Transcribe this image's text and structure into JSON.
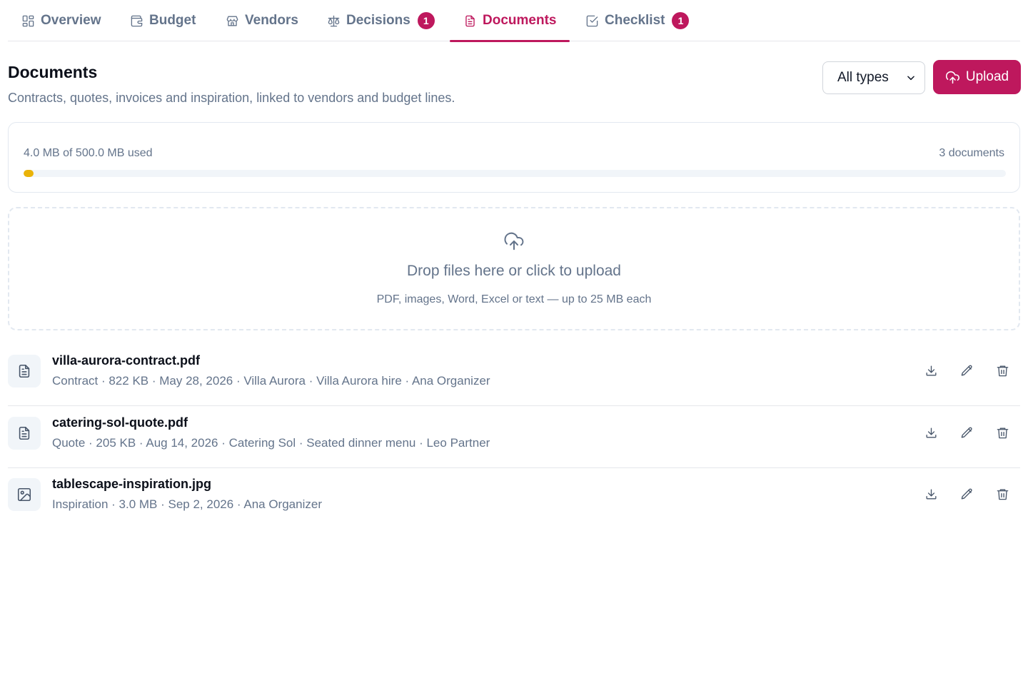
{
  "tabs": [
    {
      "label": "Overview",
      "icon": "grid-icon",
      "badge": null
    },
    {
      "label": "Budget",
      "icon": "wallet-icon",
      "badge": null
    },
    {
      "label": "Vendors",
      "icon": "store-icon",
      "badge": null
    },
    {
      "label": "Decisions",
      "icon": "scale-icon",
      "badge": "1"
    },
    {
      "label": "Documents",
      "icon": "file-text-icon",
      "badge": null,
      "active": true
    },
    {
      "label": "Checklist",
      "icon": "checkbox-icon",
      "badge": "1"
    }
  ],
  "header": {
    "title": "Documents",
    "subtitle": "Contracts, quotes, invoices and inspiration, linked to vendors and budget lines.",
    "filter_selected": "All types",
    "upload_label": "Upload"
  },
  "storage": {
    "used_text": "4.0 MB of 500.0 MB used",
    "count_text": "3 documents",
    "used_fraction": 0.008
  },
  "dropzone": {
    "title": "Drop files here or click to upload",
    "hint": "PDF, images, Word, Excel or text — up to 25 MB each"
  },
  "documents": [
    {
      "name": "villa-aurora-contract.pdf",
      "icon": "file-text-icon",
      "meta": [
        "Contract",
        "822 KB",
        "May 28, 2026",
        "Villa Aurora",
        "Villa Aurora hire",
        "Ana Organizer"
      ]
    },
    {
      "name": "catering-sol-quote.pdf",
      "icon": "file-text-icon",
      "meta": [
        "Quote",
        "205 KB",
        "Aug 14, 2026",
        "Catering Sol",
        "Seated dinner menu",
        "Leo Partner"
      ]
    },
    {
      "name": "tablescape-inspiration.jpg",
      "icon": "image-icon",
      "meta": [
        "Inspiration",
        "3.0 MB",
        "Sep 2, 2026",
        "Ana Organizer"
      ]
    }
  ],
  "colors": {
    "accent": "#be185d",
    "storage_bar": "#eab308",
    "muted_text": "#64748b"
  }
}
